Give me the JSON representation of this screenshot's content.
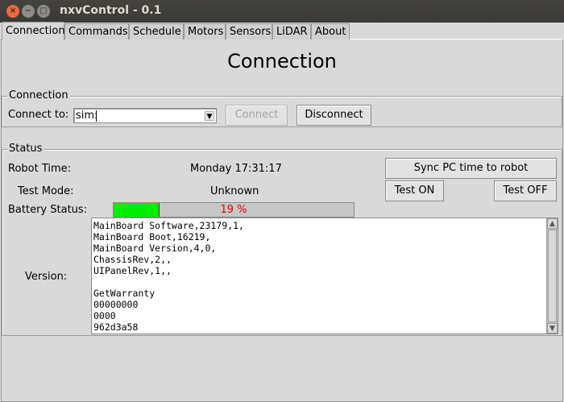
{
  "window": {
    "title": "nxvControl - 0.1",
    "close_glyph": "×",
    "min_glyph": "−",
    "max_glyph": "□"
  },
  "tabs": [
    "Connection",
    "Commands",
    "Schedule",
    "Motors",
    "Sensors",
    "LiDAR",
    "About"
  ],
  "active_tab": "Connection",
  "page_title": "Connection",
  "connection": {
    "group_title": "Connection",
    "connect_to_label": "Connect to:",
    "connect_to_value": "sim:",
    "connect_button": "Connect",
    "disconnect_button": "Disconnect"
  },
  "status": {
    "group_title": "Status",
    "robot_time_label": "Robot Time:",
    "robot_time_value": "Monday 17:31:17",
    "sync_button": "Sync PC time to robot",
    "test_mode_label": "Test Mode:",
    "test_mode_value": "Unknown",
    "test_on_button": "Test ON",
    "test_off_button": "Test OFF",
    "battery_label": "Battery Status:",
    "battery_percent": 19,
    "battery_text": "19 %",
    "version_label": "Version:",
    "version_lines": [
      "MainBoard Software,23179,1,",
      "MainBoard Boot,16219,",
      "MainBoard Version,4,0,",
      "ChassisRev,2,,",
      "UIPanelRev,1,,",
      "",
      "GetWarranty",
      "00000000",
      "0000",
      "962d3a58"
    ]
  },
  "colors": {
    "battery_fill": "#00ee00",
    "battery_text": "#e00000",
    "titlebar": "#3c3b37",
    "close_button": "#ec6a3f"
  }
}
